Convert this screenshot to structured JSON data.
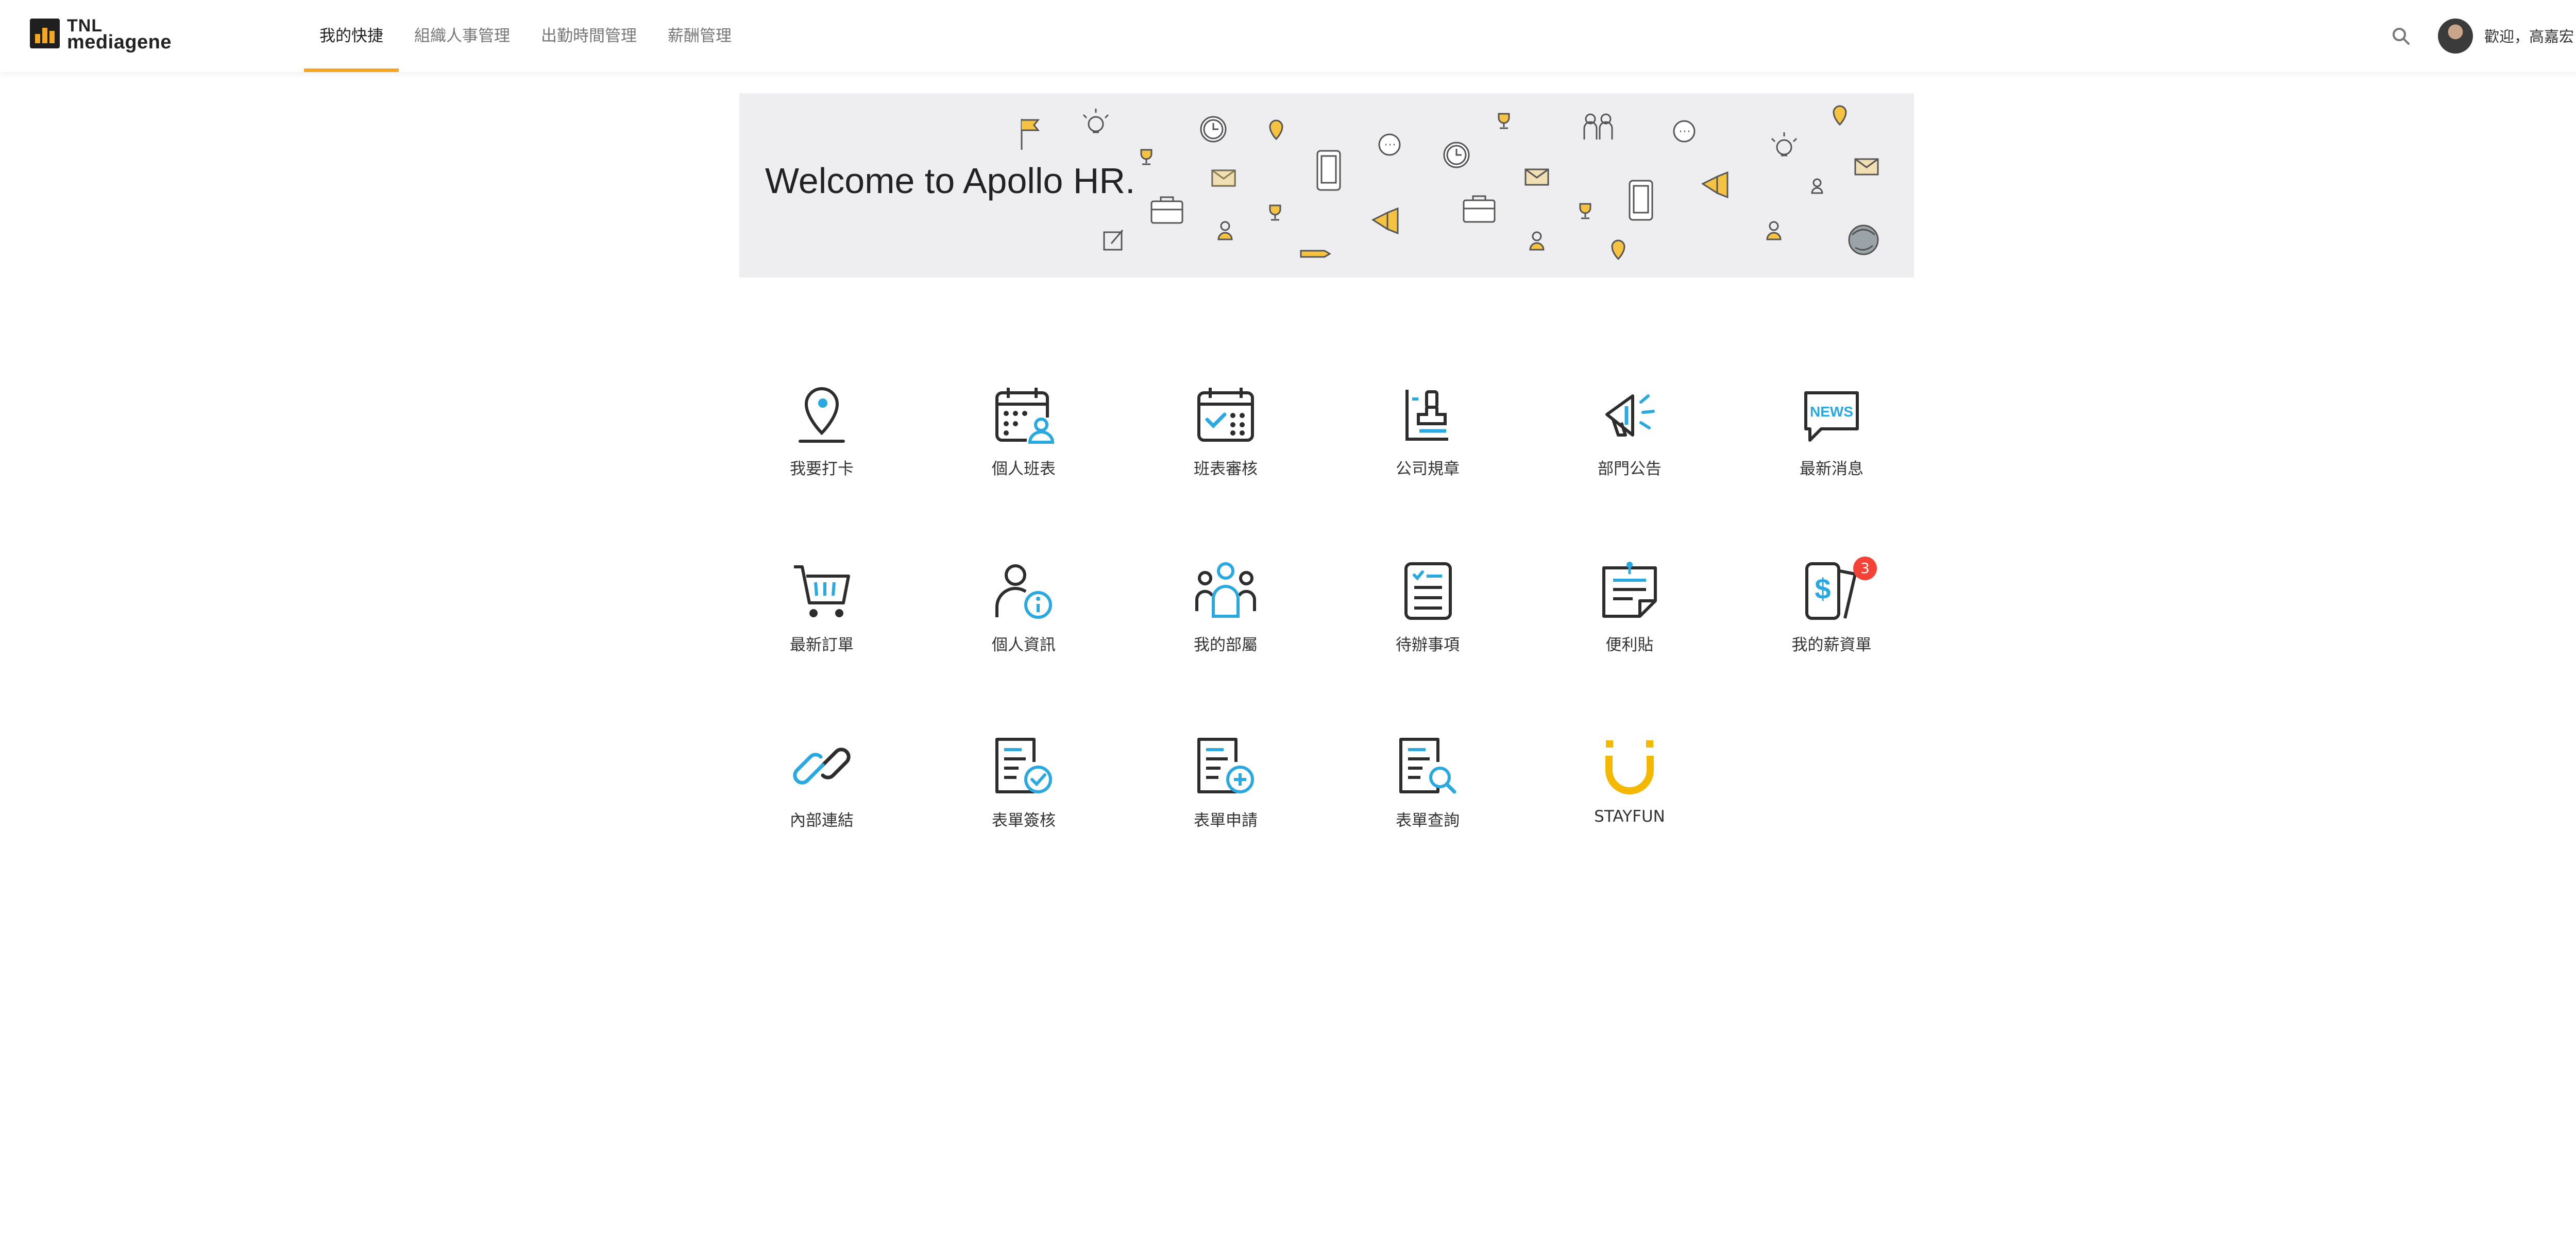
{
  "header": {
    "logo_line1": "TNL",
    "logo_line2": "mediagene",
    "nav": [
      {
        "label": "我的快捷",
        "active": true
      },
      {
        "label": "組織人事管理",
        "active": false
      },
      {
        "label": "出勤時間管理",
        "active": false
      },
      {
        "label": "薪酬管理",
        "active": false
      }
    ],
    "welcome_text": "歡迎，高嘉宏 Loso"
  },
  "banner": {
    "title": "Welcome to Apollo HR."
  },
  "tiles": [
    {
      "label": "我要打卡",
      "icon": "map-pin-icon"
    },
    {
      "label": "個人班表",
      "icon": "calendar-person-icon"
    },
    {
      "label": "班表審核",
      "icon": "calendar-check-icon"
    },
    {
      "label": "公司規章",
      "icon": "stamp-icon"
    },
    {
      "label": "部門公告",
      "icon": "megaphone-icon"
    },
    {
      "label": "最新消息",
      "icon": "news-bubble-icon"
    },
    {
      "label": "最新訂單",
      "icon": "shopping-cart-icon"
    },
    {
      "label": "個人資訊",
      "icon": "person-info-icon"
    },
    {
      "label": "我的部屬",
      "icon": "team-icon"
    },
    {
      "label": "待辦事項",
      "icon": "checklist-icon"
    },
    {
      "label": "便利貼",
      "icon": "sticky-note-icon"
    },
    {
      "label": "我的薪資單",
      "icon": "payslip-icon",
      "badge": "3"
    },
    {
      "label": "內部連結",
      "icon": "link-icon"
    },
    {
      "label": "表單簽核",
      "icon": "form-approve-icon"
    },
    {
      "label": "表單申請",
      "icon": "form-add-icon"
    },
    {
      "label": "表單查詢",
      "icon": "form-search-icon"
    },
    {
      "label": "STAYFUN",
      "icon": "stayfun-smile-icon"
    }
  ],
  "colors": {
    "accent": "#f5a623",
    "icon_dark": "#2d2d2d",
    "icon_blue": "#29a9e0",
    "badge": "#f44336",
    "banner_bg": "#eeeef1"
  }
}
